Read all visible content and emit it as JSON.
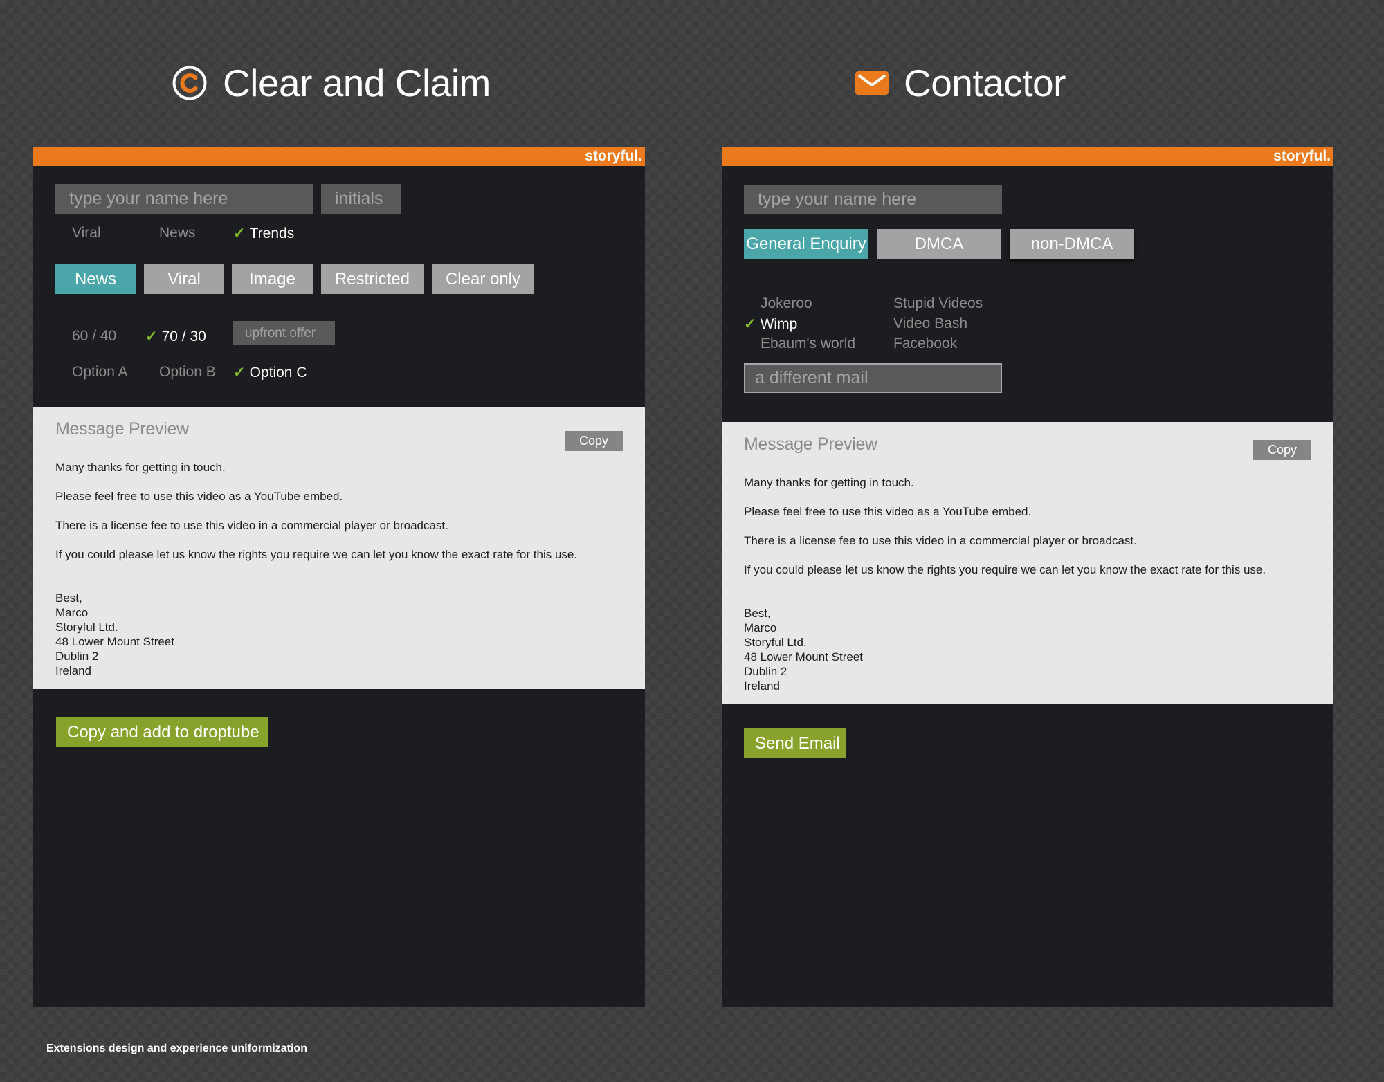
{
  "left": {
    "heading": "Clear and Claim",
    "icon": "copyright-c-icon",
    "brand": "storyful.",
    "name_placeholder": "type your name here",
    "initials_placeholder": "initials",
    "categories": [
      "Viral",
      "News",
      "Trends"
    ],
    "selected_category": "Trends",
    "license_buttons": [
      "News",
      "Viral",
      "Image",
      "Restricted",
      "Clear only"
    ],
    "active_license": "News",
    "splits": [
      "60 / 40",
      "70 / 30"
    ],
    "selected_split": "70 / 30",
    "upfront_offer": "upfront offer",
    "options": [
      "Option A",
      "Option B",
      "Option C"
    ],
    "selected_option": "Option C",
    "preview": {
      "title": "Message Preview",
      "copy_label": "Copy",
      "lines": [
        "Many thanks for getting in touch.",
        "Please feel free to use this video as a YouTube embed.",
        "There is a license fee to use this video in a commercial player or broadcast.",
        "If you could please let us know the rights you require we can let you know the exact rate for this use."
      ],
      "signature": [
        "Best,",
        "Marco",
        "Storyful Ltd.",
        "48 Lower Mount Street",
        "Dublin 2",
        "Ireland"
      ]
    },
    "action_label": "Copy and add to droptube"
  },
  "right": {
    "heading": "Contactor",
    "icon": "envelope-icon",
    "brand": "storyful.",
    "name_placeholder": "type your name here",
    "type_buttons": [
      "General Enquiry",
      "DMCA",
      "non-DMCA"
    ],
    "active_type": "General Enquiry",
    "sites_col1": [
      "Jokeroo",
      "Wimp",
      "Ebaum's world"
    ],
    "sites_col2": [
      "Stupid Videos",
      "Video Bash",
      "Facebook"
    ],
    "selected_site": "Wimp",
    "mail_placeholder": "a different mail",
    "preview": {
      "title": "Message Preview",
      "copy_label": "Copy",
      "lines": [
        "Many thanks for getting in touch.",
        "Please feel free to use this video as a YouTube embed.",
        "There is a license fee to use this video in a commercial player or broadcast.",
        "If you could please let us know the rights you require we can let you know the exact rate for this use."
      ],
      "signature": [
        "Best,",
        "Marco",
        "Storyful Ltd.",
        "48 Lower Mount Street",
        "Dublin 2",
        "Ireland"
      ]
    },
    "action_label": "Send Email"
  },
  "footer": "Extensions design and experience uniformization",
  "colors": {
    "accent": "#ea7a1c",
    "teal": "#4aa6a8",
    "green": "#88a32c",
    "check": "#7fb92d",
    "panel": "#1c1d20"
  }
}
